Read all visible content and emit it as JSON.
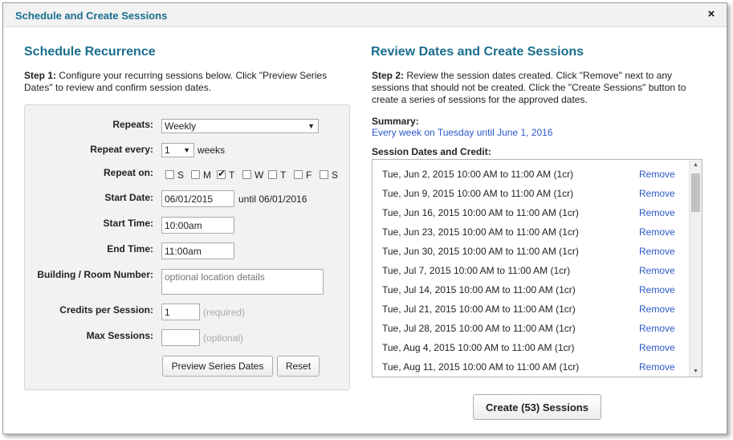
{
  "dialog": {
    "title": "Schedule and Create Sessions",
    "close_icon": "×"
  },
  "left": {
    "heading": "Schedule Recurrence",
    "step_label": "Step 1:",
    "step_text": " Configure your recurring sessions below. Click \"Preview Series Dates\" to review and confirm session dates.",
    "form": {
      "repeats_label": "Repeats:",
      "repeats_value": "Weekly",
      "repeat_every_label": "Repeat every:",
      "repeat_every_value": "1",
      "repeat_every_unit": "weeks",
      "repeat_on_label": "Repeat on:",
      "days": [
        {
          "label": "S",
          "checked": false
        },
        {
          "label": "M",
          "checked": false
        },
        {
          "label": "T",
          "checked": true
        },
        {
          "label": "W",
          "checked": false
        },
        {
          "label": "T",
          "checked": false
        },
        {
          "label": "F",
          "checked": false
        },
        {
          "label": "S",
          "checked": false
        }
      ],
      "start_date_label": "Start Date:",
      "start_date_value": "06/01/2015",
      "until_text": "until 06/01/2016",
      "start_time_label": "Start Time:",
      "start_time_value": "10:00am",
      "end_time_label": "End Time:",
      "end_time_value": "11:00am",
      "room_label": "Building / Room Number:",
      "room_placeholder": "optional location details",
      "credits_label": "Credits per Session:",
      "credits_value": "1",
      "credits_hint": "(required)",
      "max_label": "Max Sessions:",
      "max_value": "",
      "max_hint": "(optional)",
      "preview_button": "Preview Series Dates",
      "reset_button": "Reset"
    }
  },
  "right": {
    "heading": "Review Dates and Create Sessions",
    "step_label": "Step 2:",
    "step_text": " Review the session dates created. Click \"Remove\" next to any sessions that should not be created. Click the \"Create Sessions\" button to create a series of sessions for the approved dates.",
    "summary_label": "Summary:",
    "summary_text": "Every week on Tuesday until June 1, 2016",
    "list_label": "Session Dates and Credit:",
    "remove_label": "Remove",
    "sessions": [
      "Tue, Jun 2, 2015 10:00 AM to 11:00 AM (1cr)",
      "Tue, Jun 9, 2015 10:00 AM to 11:00 AM (1cr)",
      "Tue, Jun 16, 2015 10:00 AM to 11:00 AM (1cr)",
      "Tue, Jun 23, 2015 10:00 AM to 11:00 AM (1cr)",
      "Tue, Jun 30, 2015 10:00 AM to 11:00 AM (1cr)",
      "Tue, Jul 7, 2015 10:00 AM to 11:00 AM (1cr)",
      "Tue, Jul 14, 2015 10:00 AM to 11:00 AM (1cr)",
      "Tue, Jul 21, 2015 10:00 AM to 11:00 AM (1cr)",
      "Tue, Jul 28, 2015 10:00 AM to 11:00 AM (1cr)",
      "Tue, Aug 4, 2015 10:00 AM to 11:00 AM (1cr)",
      "Tue, Aug 11, 2015 10:00 AM to 11:00 AM (1cr)"
    ],
    "create_button": "Create (53) Sessions"
  },
  "colors": {
    "heading": "#1a6e8e",
    "link": "#2a58c8"
  }
}
